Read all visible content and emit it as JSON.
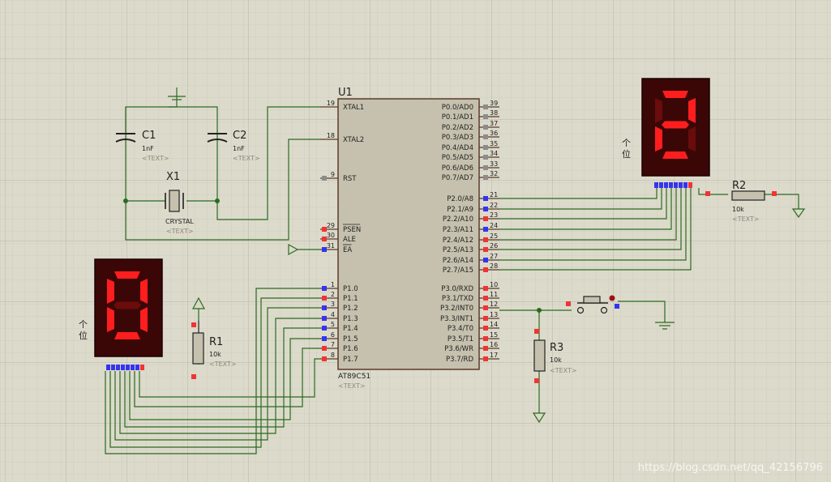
{
  "colors": {
    "background": "#dcdacb",
    "grid_minor": "#cdcbbb",
    "grid_major": "#b9b7a6",
    "wire": "#2a6b1f",
    "chip_fill": "#c5c1ae",
    "pin_blue": "#3434f0",
    "pin_red": "#f03434",
    "pin_gray": "#8c8c8c",
    "seg_on": "#ff1e1e",
    "seg_off": "#6a0c0c",
    "display_body": "#3b0606"
  },
  "mcu": {
    "ref": "U1",
    "part": "AT89C51",
    "text_placeholder": "<TEXT>",
    "left_pins": [
      {
        "num": "19",
        "name": "XTAL1"
      },
      {
        "num": "18",
        "name": "XTAL2"
      },
      {
        "num": "9",
        "name": "RST"
      },
      {
        "num": "29",
        "name": "PSEN"
      },
      {
        "num": "30",
        "name": "ALE"
      },
      {
        "num": "31",
        "name": "EA"
      },
      {
        "num": "1",
        "name": "P1.0"
      },
      {
        "num": "2",
        "name": "P1.1"
      },
      {
        "num": "3",
        "name": "P1.2"
      },
      {
        "num": "4",
        "name": "P1.3"
      },
      {
        "num": "5",
        "name": "P1.4"
      },
      {
        "num": "6",
        "name": "P1.5"
      },
      {
        "num": "7",
        "name": "P1.6"
      },
      {
        "num": "8",
        "name": "P1.7"
      }
    ],
    "right_pins": [
      {
        "num": "39",
        "name": "P0.0/AD0"
      },
      {
        "num": "38",
        "name": "P0.1/AD1"
      },
      {
        "num": "37",
        "name": "P0.2/AD2"
      },
      {
        "num": "36",
        "name": "P0.3/AD3"
      },
      {
        "num": "35",
        "name": "P0.4/AD4"
      },
      {
        "num": "34",
        "name": "P0.5/AD5"
      },
      {
        "num": "33",
        "name": "P0.6/AD6"
      },
      {
        "num": "32",
        "name": "P0.7/AD7"
      },
      {
        "num": "21",
        "name": "P2.0/A8"
      },
      {
        "num": "22",
        "name": "P2.1/A9"
      },
      {
        "num": "23",
        "name": "P2.2/A10"
      },
      {
        "num": "24",
        "name": "P2.3/A11"
      },
      {
        "num": "25",
        "name": "P2.4/A12"
      },
      {
        "num": "26",
        "name": "P2.5/A13"
      },
      {
        "num": "27",
        "name": "P2.6/A14"
      },
      {
        "num": "28",
        "name": "P2.7/A15"
      },
      {
        "num": "10",
        "name": "P3.0/RXD"
      },
      {
        "num": "11",
        "name": "P3.1/TXD"
      },
      {
        "num": "12",
        "name": "P3.2/INT0"
      },
      {
        "num": "13",
        "name": "P3.3/INT1"
      },
      {
        "num": "14",
        "name": "P3.4/T0"
      },
      {
        "num": "15",
        "name": "P3.5/T1"
      },
      {
        "num": "16",
        "name": "P3.6/WR"
      },
      {
        "num": "17",
        "name": "P3.7/RD"
      }
    ]
  },
  "components": {
    "c1": {
      "ref": "C1",
      "value": "1nF",
      "text": "<TEXT>"
    },
    "c2": {
      "ref": "C2",
      "value": "1nF",
      "text": "<TEXT>"
    },
    "x1": {
      "ref": "X1",
      "value": "CRYSTAL",
      "text": "<TEXT>"
    },
    "r1": {
      "ref": "R1",
      "value": "10k",
      "text": "<TEXT>"
    },
    "r2": {
      "ref": "R2",
      "value": "10k",
      "text": "<TEXT>"
    },
    "r3": {
      "ref": "R3",
      "value": "10k",
      "text": "<TEXT>"
    }
  },
  "displays": {
    "left": {
      "digit": "0",
      "label_1": "个",
      "label_2": "位"
    },
    "right": {
      "digit": "2",
      "label_1": "个",
      "label_2": "位"
    }
  },
  "watermark": "https://blog.csdn.net/qq_42156796"
}
